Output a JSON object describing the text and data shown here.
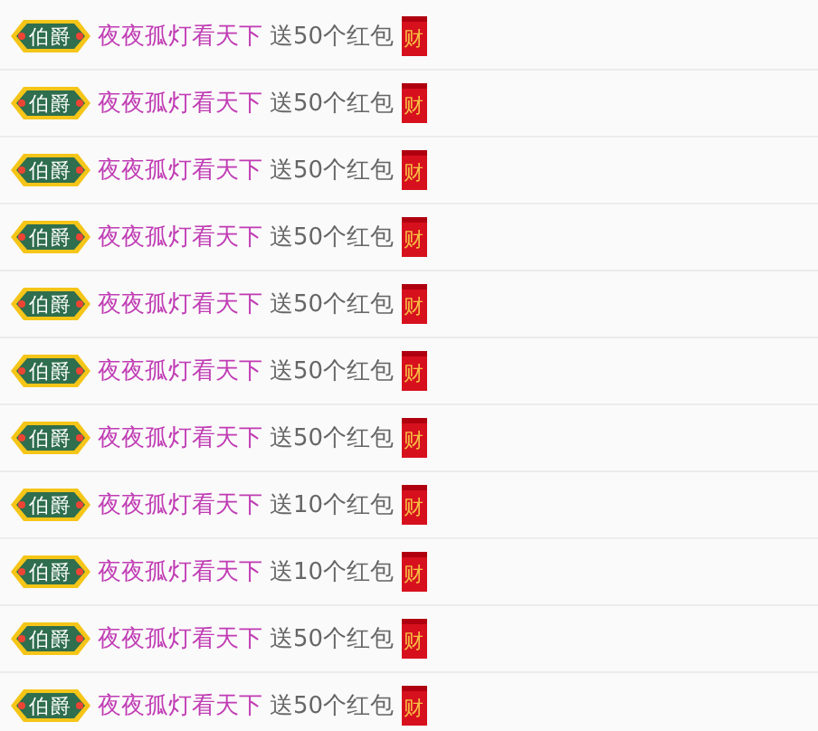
{
  "messages": [
    {
      "badge": "伯爵",
      "user": "夜夜孤灯看天下",
      "action": "送50个红包",
      "envelope": "财"
    },
    {
      "badge": "伯爵",
      "user": "夜夜孤灯看天下",
      "action": "送50个红包",
      "envelope": "财"
    },
    {
      "badge": "伯爵",
      "user": "夜夜孤灯看天下",
      "action": "送50个红包",
      "envelope": "财"
    },
    {
      "badge": "伯爵",
      "user": "夜夜孤灯看天下",
      "action": "送50个红包",
      "envelope": "财"
    },
    {
      "badge": "伯爵",
      "user": "夜夜孤灯看天下",
      "action": "送50个红包",
      "envelope": "财"
    },
    {
      "badge": "伯爵",
      "user": "夜夜孤灯看天下",
      "action": "送50个红包",
      "envelope": "财"
    },
    {
      "badge": "伯爵",
      "user": "夜夜孤灯看天下",
      "action": "送50个红包",
      "envelope": "财"
    },
    {
      "badge": "伯爵",
      "user": "夜夜孤灯看天下",
      "action": "送10个红包",
      "envelope": "财"
    },
    {
      "badge": "伯爵",
      "user": "夜夜孤灯看天下",
      "action": "送10个红包",
      "envelope": "财"
    },
    {
      "badge": "伯爵",
      "user": "夜夜孤灯看天下",
      "action": "送50个红包",
      "envelope": "财"
    },
    {
      "badge": "伯爵",
      "user": "夜夜孤灯看天下",
      "action": "送50个红包",
      "envelope": "财"
    }
  ]
}
